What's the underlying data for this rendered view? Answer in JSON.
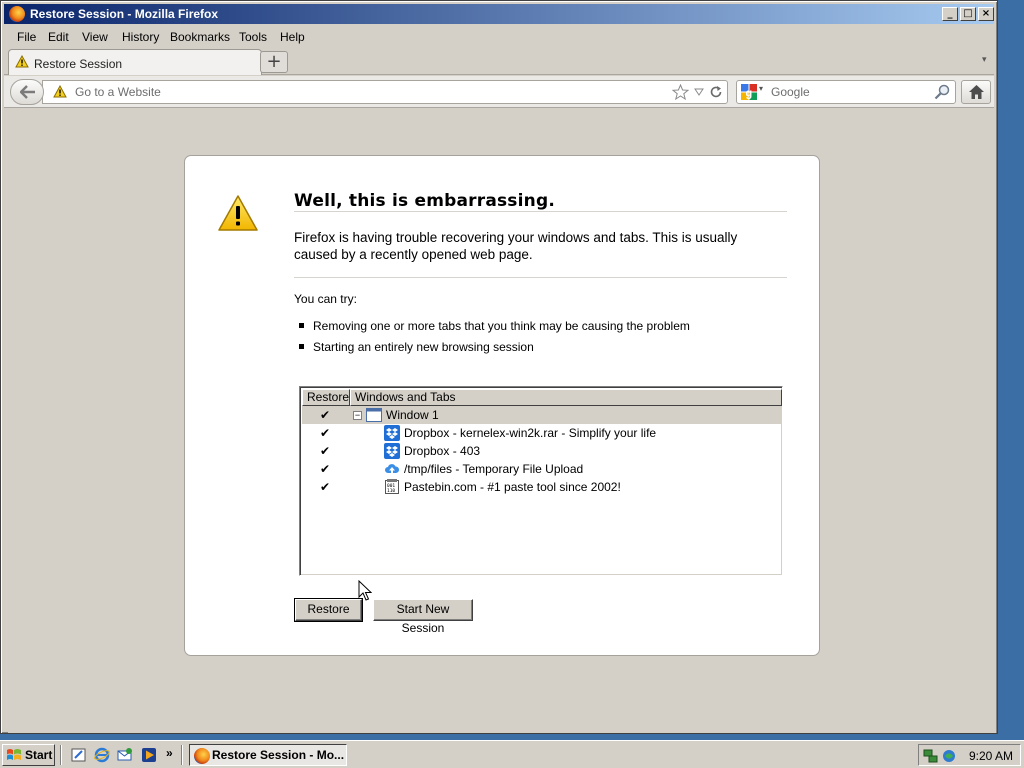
{
  "window": {
    "title": "Restore Session - Mozilla Firefox"
  },
  "menu": [
    "File",
    "Edit",
    "View",
    "History",
    "Bookmarks",
    "Tools",
    "Help"
  ],
  "tabs": [
    {
      "label": "Restore Session",
      "icon": "warning-icon",
      "active": true
    }
  ],
  "navbar": {
    "url_placeholder": "Go to a Website",
    "search_placeholder": "Google",
    "search_engine_icon": "google-icon"
  },
  "error_page": {
    "title": "Well, this is embarrassing.",
    "description": "Firefox is having trouble recovering your windows and tabs. This is usually caused by a recently opened web page.",
    "you_can_try": "You can try:",
    "suggestions": [
      "Removing one or more tabs that you think may be causing the problem",
      "Starting an entirely new browsing session"
    ],
    "tree": {
      "columns": [
        "Restore",
        "Windows and Tabs"
      ],
      "rows": [
        {
          "checked": true,
          "label": "Window 1",
          "type": "window",
          "icon": "window-icon",
          "selected": true
        },
        {
          "checked": true,
          "label": "Dropbox - kernelex-win2k.rar - Simplify your life",
          "type": "tab",
          "icon": "dropbox-icon"
        },
        {
          "checked": true,
          "label": "Dropbox - 403",
          "type": "tab",
          "icon": "dropbox-icon"
        },
        {
          "checked": true,
          "label": "/tmp/files - Temporary File Upload",
          "type": "tab",
          "icon": "cloud-upload-icon"
        },
        {
          "checked": true,
          "label": "Pastebin.com - #1 paste tool since 2002!",
          "type": "tab",
          "icon": "pastebin-icon"
        }
      ]
    },
    "buttons": {
      "restore": "Restore",
      "start_new": "Start New Session"
    }
  },
  "taskbar": {
    "start_label": "Start",
    "quicklaunch": [
      "show-desktop-icon",
      "internet-explorer-icon",
      "outlook-express-icon",
      "media-player-icon"
    ],
    "more": "»",
    "active_task": "Restore Session - Mo...",
    "clock": "9:20 AM"
  },
  "colors": {
    "titlebar_start": "#0a246a",
    "titlebar_end": "#a6caf0",
    "chrome": "#d4d0c8",
    "dropbox": "#1f6fd6"
  }
}
